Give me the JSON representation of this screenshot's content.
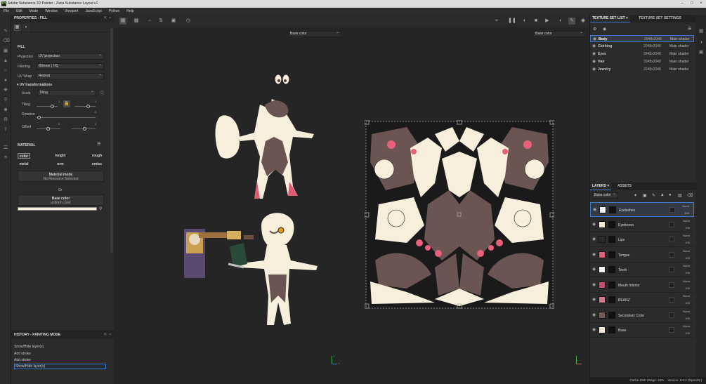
{
  "window": {
    "title": "Adobe Substance 3D Painter - Zaria Substance Layout v1"
  },
  "menu": [
    "File",
    "Edit",
    "Mode",
    "Window",
    "Viewport",
    "JavaScript",
    "Python",
    "Help"
  ],
  "properties": {
    "title": "PROPERTIES - FILL",
    "section_fill": "FILL",
    "projection_label": "Projection",
    "projection_value": "UV projection",
    "filtering_label": "Filtering",
    "filtering_value": "Bilinear | HQ",
    "uvwrap_label": "UV Wrap",
    "uvwrap_value": "Repeat",
    "uvtransform_title": "UV transformations",
    "scale_label": "Scale",
    "scale_value": "Tiling",
    "tiling_label": "Tiling",
    "tiling_v1": "1",
    "tiling_v2": "1",
    "rotation_label": "Rotation",
    "rotation_v": "0",
    "offset_label": "Offset",
    "offset_v1": "0",
    "offset_v2": "0",
    "material_title": "MATERIAL",
    "channels": [
      "color",
      "height",
      "rough",
      "metal",
      "nrm",
      "emiss"
    ],
    "material_mode_title": "Material mode",
    "material_mode_sub": "No Resource Selected",
    "or_text": "Or",
    "base_color_title": "Base color",
    "base_color_sub": "uniform color",
    "base_color_swatch": "#f7eedc"
  },
  "history": {
    "title": "HISTORY - PAINTING MODE",
    "items": [
      "Show/Hide layer(s)",
      "Add stroke",
      "Add stroke",
      "Show/Hide layer(s)"
    ]
  },
  "viewport": {
    "left_channel": "Base color",
    "right_channel": "Base color",
    "axis_y": "Y",
    "axis_x": "X"
  },
  "texture_sets": {
    "tab_list": "TEXTURE SET LIST",
    "tab_settings": "TEXTURE SET SETTINGS",
    "rows": [
      {
        "name": "Body",
        "res": "2048x2048",
        "shader": "Main shader"
      },
      {
        "name": "Clothing",
        "res": "2048x2048",
        "shader": "Main shader"
      },
      {
        "name": "Eyes",
        "res": "2048x2048",
        "shader": "Main shader"
      },
      {
        "name": "Hair",
        "res": "2048x2048",
        "shader": "Main shader"
      },
      {
        "name": "Jewelry",
        "res": "2048x2048",
        "shader": "Main shader"
      }
    ]
  },
  "layers": {
    "tab_layers": "LAYERS",
    "tab_assets": "ASSETS",
    "channel": "Base color",
    "items": [
      {
        "name": "Eyelashes",
        "blend": "Norm",
        "opacity": "100",
        "color": "#f4f4f4"
      },
      {
        "name": "Eyebrows",
        "blend": "Norm",
        "opacity": "100",
        "color": "#f6ead4"
      },
      {
        "name": "Lips",
        "blend": "Norm",
        "opacity": "100",
        "color": "#2a2a2a"
      },
      {
        "name": "Tongue",
        "blend": "Norm",
        "opacity": "100",
        "color": "#e0607a"
      },
      {
        "name": "Teeth",
        "blend": "Norm",
        "opacity": "100",
        "color": "#f4f4f4"
      },
      {
        "name": "Mouth Interior",
        "blend": "Norm",
        "opacity": "100",
        "color": "#c2506a"
      },
      {
        "name": "BEANZ",
        "blend": "Norm",
        "opacity": "100",
        "color": "#d47a8a"
      },
      {
        "name": "Secondary Color",
        "blend": "Norm",
        "opacity": "100",
        "color": "#7a5a56"
      },
      {
        "name": "Base",
        "blend": "Norm",
        "opacity": "100",
        "color": "#f6ead4"
      }
    ]
  },
  "status": {
    "cache_label": "Cache Disk Usage:",
    "cache_value": "44%",
    "version": "Version: 9.0.1 (OpenGL)"
  },
  "colors": {
    "cream": "#f7eedc",
    "brown": "#6b5552",
    "pink": "#e8607a",
    "accent_blue": "#3d7ad6"
  }
}
